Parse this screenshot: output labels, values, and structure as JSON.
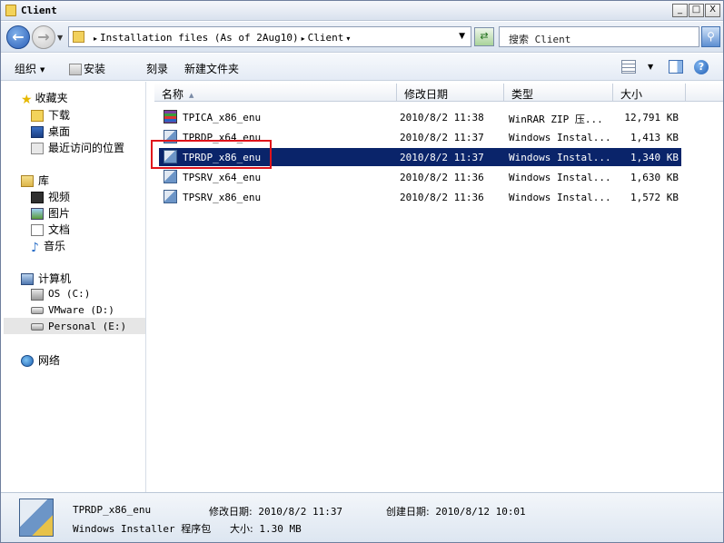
{
  "window": {
    "title": "Client",
    "min_glyph": "_",
    "max_glyph": "□",
    "close_glyph": "X"
  },
  "address": {
    "crumbs": [
      "Installation files (As of 2Aug10)",
      "Client"
    ],
    "search_placeholder": "搜索 Client"
  },
  "toolbar": {
    "organize": "组织",
    "install": "安装",
    "burn": "刻录",
    "new_folder": "新建文件夹"
  },
  "sidebar": {
    "favorites": "收藏夹",
    "downloads": "下载",
    "desktop": "桌面",
    "recent": "最近访问的位置",
    "libraries": "库",
    "videos": "视频",
    "pictures": "图片",
    "documents": "文档",
    "music": "音乐",
    "computer": "计算机",
    "drive_c": "OS (C:)",
    "drive_d": "VMware (D:)",
    "drive_e": "Personal (E:)",
    "network": "网络"
  },
  "columns": {
    "name": "名称",
    "modified": "修改日期",
    "type": "类型",
    "size": "大小"
  },
  "files": [
    {
      "name": "TPICA_x86_enu",
      "modified": "2010/8/2 11:38",
      "type": "WinRAR ZIP 压...",
      "size": "12,791 KB",
      "icon": "winrar-icon"
    },
    {
      "name": "TPRDP_x64_enu",
      "modified": "2010/8/2 11:37",
      "type": "Windows Instal...",
      "size": "1,413 KB",
      "icon": "msi-icon"
    },
    {
      "name": "TPRDP_x86_enu",
      "modified": "2010/8/2 11:37",
      "type": "Windows Instal...",
      "size": "1,340 KB",
      "icon": "msi-icon"
    },
    {
      "name": "TPSRV_x64_enu",
      "modified": "2010/8/2 11:36",
      "type": "Windows Instal...",
      "size": "1,630 KB",
      "icon": "msi-icon"
    },
    {
      "name": "TPSRV_x86_enu",
      "modified": "2010/8/2 11:36",
      "type": "Windows Instal...",
      "size": "1,572 KB",
      "icon": "msi-icon"
    }
  ],
  "details": {
    "name": "TPRDP_x86_enu",
    "type": "Windows Installer 程序包",
    "modified_label": "修改日期:",
    "modified_value": "2010/8/2 11:37",
    "created_label": "创建日期:",
    "created_value": "2010/8/12 10:01",
    "size_label": "大小:",
    "size_value": "1.30 MB"
  },
  "colors": {
    "selection": "#0a246a",
    "highlight_box": "#e0141b"
  }
}
